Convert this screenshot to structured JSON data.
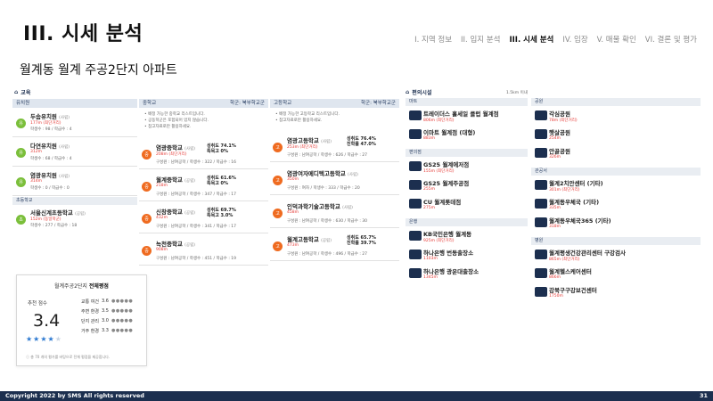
{
  "header": {
    "section_title": "III. 시세 분석",
    "nav": [
      "I. 지역 정보",
      "II. 입지 분석",
      "III. 시세 분석",
      "IV. 임장",
      "V. 매물 확인",
      "VI. 결론 및 평가"
    ],
    "active_nav_index": 2,
    "sub_title": "월계동 월계 주공2단지 아파트"
  },
  "education": {
    "title": "교육",
    "kinder": {
      "header": "유치원",
      "items": [
        {
          "name": "두솜유치원",
          "type": "(사립)",
          "dist": "177m (최단거리)",
          "meta": "학생수 : 98 / 학급수 : 4"
        },
        {
          "name": "다연유치원",
          "type": "(사립)",
          "dist": "312m",
          "meta": "학생수 : 68 / 학급수 : 4"
        },
        {
          "name": "염광유치원",
          "type": "(사립)",
          "dist": "314m",
          "meta": "학생수 : 0 / 학급수 : 0"
        }
      ],
      "nursery_header": "초등학교",
      "nursery_items": [
        {
          "name": "서울신계초등학교",
          "type": "(공립)",
          "dist": "152m (동일학군)",
          "meta": "학생수 : 277 / 학급수 : 18"
        }
      ]
    },
    "middle": {
      "header": "중학교",
      "note": "학군: 북부학교군",
      "notices": [
        "• 배정 가능한 중학교 리스트입니다.",
        "• 공동학군은 포함되어 있지 않습니다.",
        "• 참고자료로만 활용하세요."
      ],
      "items": [
        {
          "name": "염광중학교",
          "type": "(사립)",
          "dist": "208m (최단거리)",
          "rate1": "성취도 74.1%",
          "rate2": "특목고 0%",
          "meta": "구성원 : 남여공학 / 학생수 : 322 / 학급수 : 16"
        },
        {
          "name": "월계중학교",
          "type": "(공립)",
          "dist": "218m",
          "rate1": "성취도 61.6%",
          "rate2": "특목고 0%",
          "meta": "구성원 : 남여공학 / 학생수 : 347 / 학급수 : 17"
        },
        {
          "name": "신창중학교",
          "type": "(공립)",
          "dist": "432m",
          "rate1": "성취도 69.7%",
          "rate2": "특목고 3.0%",
          "meta": "구성원 : 남여공학 / 학생수 : 341 / 학급수 : 17"
        },
        {
          "name": "녹천중학교",
          "type": "(공립)",
          "dist": "908m",
          "rate1": "",
          "rate2": "",
          "meta": "구성원 : 남여공학 / 학생수 : 451 / 학급수 : 19"
        }
      ]
    },
    "high": {
      "header": "고등학교",
      "note": "학군: 북부학교군",
      "notices": [
        "• 배정 가능한 고등학교 리스트입니다.",
        "• 참고자료로만 활용하세요."
      ],
      "items": [
        {
          "name": "염광고등학교",
          "type": "(사립)",
          "dist": "253m (최단거리)",
          "rate1": "성취도 76.4%",
          "rate2": "진학률 47.0%",
          "meta": "구성원 : 남여공학 / 학생수 : 626 / 학급수 : 27"
        },
        {
          "name": "염광여자메디텍고등학교",
          "type": "(사립)",
          "dist": "350m",
          "rate1": "",
          "rate2": "",
          "meta": "구성원 : 여자 / 학생수 : 333 / 학급수 : 20"
        },
        {
          "name": "인덕과학기술고등학교",
          "type": "(사립)",
          "dist": "458m",
          "rate1": "",
          "rate2": "",
          "meta": "구성원 : 남여공학 / 학생수 : 630 / 학급수 : 30"
        },
        {
          "name": "월계고등학교",
          "type": "(공립)",
          "dist": "473m",
          "rate1": "성취도 65.7%",
          "rate2": "진학률 39.7%",
          "meta": "구성원 : 남여공학 / 학생수 : 496 / 학급수 : 27"
        }
      ]
    }
  },
  "convenience": {
    "title": "편의시설",
    "radius": "1.5km 이내",
    "left_groups": [
      {
        "header": "마트",
        "items": [
          {
            "name": "트레이더스 홀세일 클럽 월계점",
            "dist": "806m (최단거리)"
          },
          {
            "name": "이마트 월계점 (대형)",
            "dist": "883m"
          }
        ]
      },
      {
        "header": "편의점",
        "items": [
          {
            "name": "GS25 월계에저점",
            "dist": "155m (최단거리)"
          },
          {
            "name": "GS25 월계주공점",
            "dist": "255m"
          },
          {
            "name": "CU 월계롯데점",
            "dist": "275m"
          }
        ]
      },
      {
        "header": "은행",
        "items": [
          {
            "name": "KB국민은행 월계동",
            "dist": "925m (최단거리)"
          },
          {
            "name": "하나은행 번동출장소",
            "dist": "1103m"
          },
          {
            "name": "하나은행 광운대출장소",
            "dist": "1345m"
          }
        ]
      }
    ],
    "right_groups": [
      {
        "header": "공원",
        "items": [
          {
            "name": "각심공원",
            "dist": "78m (최단거리)"
          },
          {
            "name": "햇살공원",
            "dist": "254m"
          },
          {
            "name": "안골공원",
            "dist": "326m"
          }
        ]
      },
      {
        "header": "관공서",
        "items": [
          {
            "name": "월계2치안센터 (기타)",
            "dist": "301m (최단거리)"
          },
          {
            "name": "월계동우체국 (기타)",
            "dist": "335m"
          },
          {
            "name": "월계동우체국365 (기타)",
            "dist": "318m"
          }
        ]
      },
      {
        "header": "병원",
        "items": [
          {
            "name": "월계평생건강관리센터 구강검사",
            "dist": "865m (최단거리)"
          },
          {
            "name": "월계헬스케어센터",
            "dist": "866m"
          },
          {
            "name": "강북구구강보건센터",
            "dist": "1750m"
          }
        ]
      }
    ]
  },
  "rating": {
    "title_prefix": "월계주공2단지 ",
    "title_bold": "전체평점",
    "label": "추천 점수",
    "score": "3.4",
    "stars_filled": 4,
    "rows": [
      {
        "label": "교통 여건",
        "value": "3.6"
      },
      {
        "label": "주변 환경",
        "value": "3.5"
      },
      {
        "label": "단지 관리",
        "value": "3.0"
      },
      {
        "label": "거주 환경",
        "value": "3.3"
      }
    ],
    "footer": "ⓘ 총 70 개의 평가를 바탕으로 전체 평점을 제공합니다."
  },
  "footer": {
    "copyright": "Copyright 2022 by SMS All rights reserved",
    "page": "31"
  },
  "colors": {
    "navy": "#1c2f4f",
    "kinder_green": "#7bbf3b",
    "school_orange": "#ef6b20",
    "facility_blue": "#1b6fb8",
    "distance_red": "#e53935"
  }
}
